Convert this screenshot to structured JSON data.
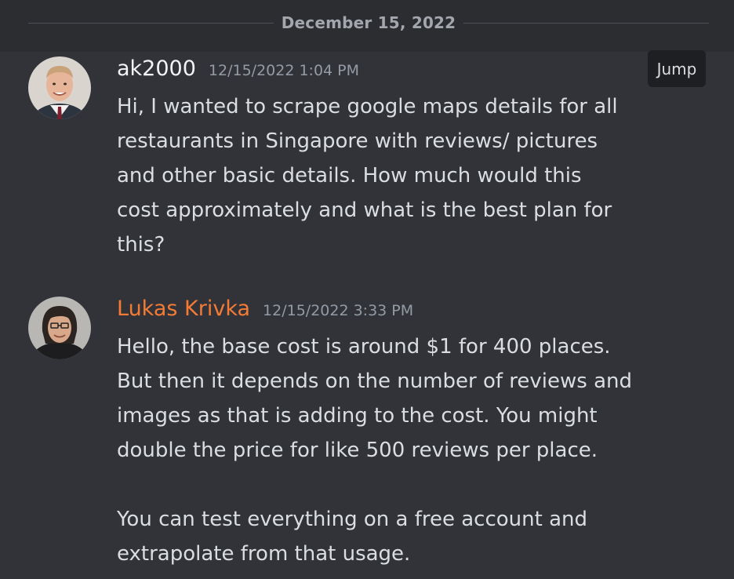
{
  "divider": {
    "date": "December 15, 2022"
  },
  "jump": {
    "label": "Jump"
  },
  "messages": [
    {
      "username": "ak2000",
      "timestamp": "12/15/2022 1:04 PM",
      "lines": [
        "Hi, I wanted to scrape google maps details for all",
        "restaurants in Singapore with reviews/ pictures",
        "and other basic details. How much would this",
        "cost approximately and what is the best plan for",
        "this?"
      ]
    },
    {
      "username": "Lukas Krivka",
      "username_color": "#f47b35",
      "timestamp": "12/15/2022 3:33 PM",
      "lines": [
        "Hello, the base cost is around $1 for 400 places.",
        "But then it depends on the number of reviews and",
        "images as that is adding to the cost. You might",
        "double the price for like 500 reviews per place."
      ],
      "lines2": [
        "You can test everything on a free account and",
        "extrapolate from that usage."
      ]
    }
  ]
}
